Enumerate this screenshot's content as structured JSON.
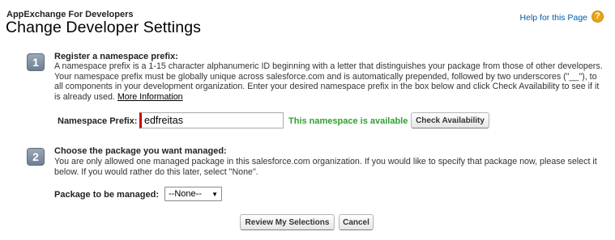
{
  "header": {
    "breadcrumb": "AppExchange For Developers",
    "title": "Change Developer Settings",
    "help_label": "Help for this Page",
    "help_icon": "?"
  },
  "step1": {
    "number": "1",
    "title": "Register a namespace prefix:",
    "description": "A namespace prefix is a 1-15 character alphanumeric ID beginning with a letter that distinguishes your package from those of other developers. Your namespace prefix must be globally unique across salesforce.com and is automatically prepended, followed by two underscores (\"__\"), to all components in your development organization. Enter your desired namespace prefix in the box below and click Check Availability to see if it is already used.",
    "more_link": "More Information",
    "namespace_label": "Namespace Prefix:",
    "namespace_value": "edfreitas",
    "status_text": "This namespace is available",
    "check_button": "Check Availability"
  },
  "step2": {
    "number": "2",
    "title": "Choose the package you want managed:",
    "description": "You are only allowed one managed package in this salesforce.com organization. If you would like to specify that package now, please select it below. If you would rather do this later, select \"None\".",
    "package_label": "Package to be managed:",
    "package_selected": "--None--"
  },
  "actions": {
    "review_button": "Review My Selections",
    "cancel_button": "Cancel"
  },
  "colors": {
    "link": "#015ba7",
    "available": "#2fa12e",
    "required": "#cc0000",
    "help_icon": "#e8a317"
  }
}
